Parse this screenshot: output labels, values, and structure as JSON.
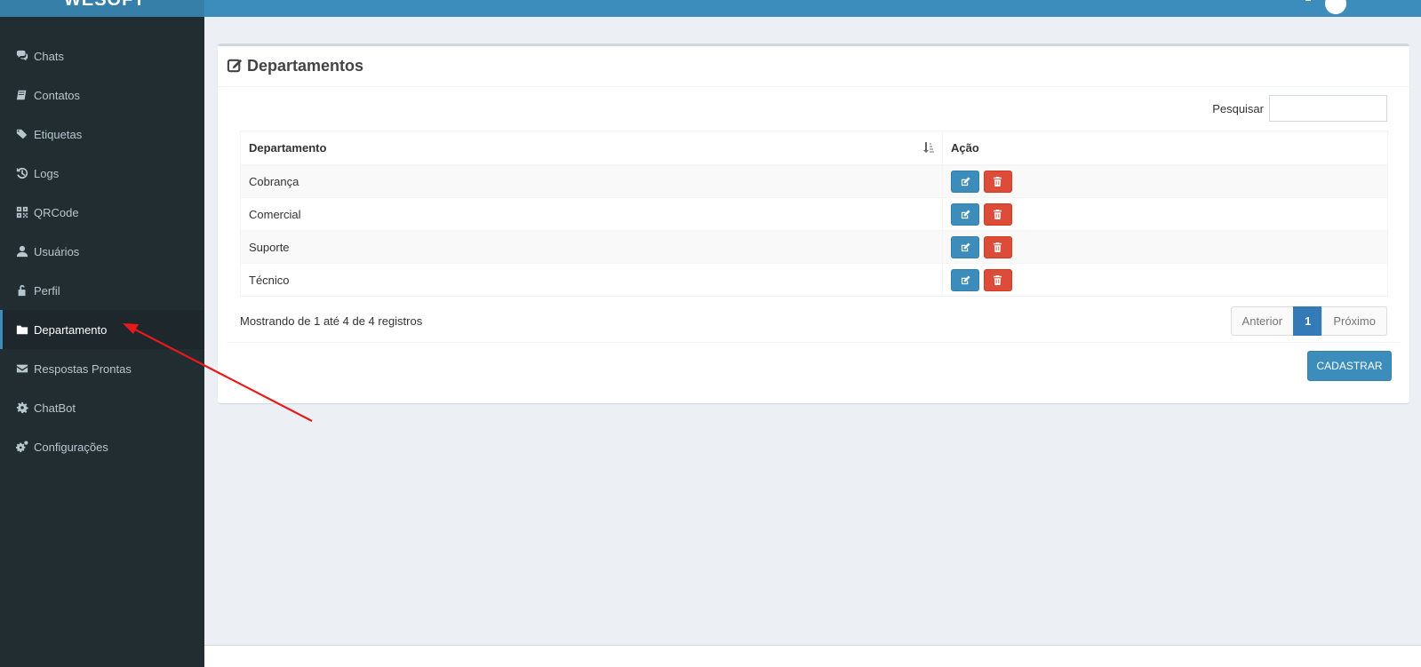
{
  "header": {
    "logo_text": "WESOFT"
  },
  "sidebar": {
    "items": [
      {
        "label": "Chats",
        "icon": "comments-icon"
      },
      {
        "label": "Contatos",
        "icon": "book-icon"
      },
      {
        "label": "Etiquetas",
        "icon": "tags-icon"
      },
      {
        "label": "Logs",
        "icon": "history-icon"
      },
      {
        "label": "QRCode",
        "icon": "qrcode-icon"
      },
      {
        "label": "Usuários",
        "icon": "user-icon"
      },
      {
        "label": "Perfil",
        "icon": "unlock-icon"
      },
      {
        "label": "Departamento",
        "icon": "folder-icon",
        "active": true
      },
      {
        "label": "Respostas Prontas",
        "icon": "envelope-icon"
      },
      {
        "label": "ChatBot",
        "icon": "cog-icon"
      },
      {
        "label": "Configurações",
        "icon": "cogs-icon"
      }
    ]
  },
  "main": {
    "title": "Departamentos",
    "search_label": "Pesquisar",
    "search_value": "",
    "table": {
      "columns": [
        "Departamento",
        "Ação"
      ],
      "rows": [
        {
          "departamento": "Cobrança"
        },
        {
          "departamento": "Comercial"
        },
        {
          "departamento": "Suporte"
        },
        {
          "departamento": "Técnico"
        }
      ]
    },
    "info": "Mostrando de 1 até 4 de 4 registros",
    "pagination": {
      "previous": "Anterior",
      "current": "1",
      "next": "Próximo"
    },
    "cadastrar_label": "CADASTRAR"
  },
  "colors": {
    "header": "#3c8dbc",
    "sidebar": "#222d32",
    "edit_button": "#3c8dbc",
    "delete_button": "#dd4b39",
    "annotation_arrow": "#e8191a"
  }
}
